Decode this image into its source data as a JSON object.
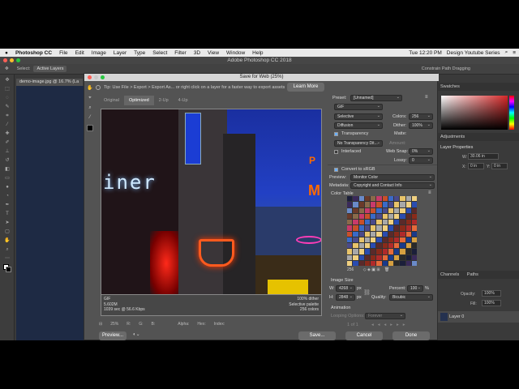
{
  "menubar": {
    "apple": "",
    "app": "Photoshop CC",
    "items": [
      "File",
      "Edit",
      "Image",
      "Layer",
      "Type",
      "Select",
      "Filter",
      "3D",
      "View",
      "Window",
      "Help"
    ],
    "clock": "Tue 12:20 PM",
    "account": "Design Youtube Series"
  },
  "ps": {
    "window_title": "Adobe Photoshop CC 2018",
    "options": {
      "select_label": "Select:",
      "select_value": "Active Layers",
      "right_text": "Constrain Path Dragging"
    },
    "doc_tab": "demo-image.jpg @ 16.7% (La",
    "panels": {
      "swatches": "Swatches",
      "adjustments": "Adjustments",
      "layer_properties": "Layer Properties",
      "w_label": "W:",
      "w_value": "30.06 in",
      "x_label": "X:",
      "x_value": "0 in",
      "h_label": "Y:",
      "y_value": "0 in",
      "channels": "Channels",
      "paths": "Paths",
      "opacity_label": "Opacity:",
      "opacity_value": "100%",
      "fill_label": "Fill:",
      "fill_value": "100%",
      "layer_name": "Layer 0"
    }
  },
  "dialog": {
    "title": "Save for Web (25%)",
    "tip": "Tip: Use File > Export > Export As... or right click on a layer for a faster way to export assets",
    "learn_more": "Learn More",
    "tabs": [
      "Original",
      "Optimized",
      "2-Up",
      "4-Up"
    ],
    "active_tab": "Optimized",
    "preview_sign": "iner",
    "preview_info_left": [
      "GIF",
      "5.602M",
      "1039 sec @ 56.6 Kbps"
    ],
    "preview_info_right": [
      "100% dither",
      "Selective palette",
      "256 colors"
    ],
    "status": {
      "zoom": "25%",
      "r": "R:",
      "g": "G:",
      "b": "B:",
      "alpha": "Alpha:",
      "hex": "Hex:",
      "index": "Index:"
    },
    "buttons": {
      "preview": "Preview...",
      "save": "Save...",
      "cancel": "Cancel",
      "done": "Done"
    },
    "settings": {
      "preset_label": "Preset:",
      "preset_value": "[Unnamed]",
      "format": "GIF",
      "reduction": "Selective",
      "colors_label": "Colors:",
      "colors_value": "256",
      "dither_algo": "Diffusion",
      "dither_label": "Dither:",
      "dither_value": "100%",
      "transparency_label": "Transparency",
      "matte_label": "Matte:",
      "trans_dither": "No Transparency Dit...",
      "amount_label": "Amount:",
      "interlaced_label": "Interlaced",
      "websnap_label": "Web Snap:",
      "websnap_value": "0%",
      "lossy_label": "Lossy:",
      "lossy_value": "0",
      "convert_srgb": "Convert to sRGB",
      "preview_label": "Preview:",
      "preview_value": "Monitor Color",
      "metadata_label": "Metadata:",
      "metadata_value": "Copyright and Contact Info",
      "color_table_label": "Color Table",
      "color_count": "256",
      "image_size_label": "Image Size",
      "w_label": "W:",
      "w_value": "4268",
      "h_label": "H:",
      "h_value": "2848",
      "px": "px",
      "percent_label": "Percent:",
      "percent_value": "100",
      "percent_unit": "%",
      "quality_label": "Quality:",
      "quality_value": "Bicubic",
      "animation_label": "Animation",
      "looping_label": "Looping Options:",
      "looping_value": "Forever",
      "frame_counter": "1 of 1"
    }
  },
  "colors": {
    "dialog_bg": "#535353",
    "ps_bg": "#3a3a3a",
    "accent": "#6ab0ff"
  }
}
